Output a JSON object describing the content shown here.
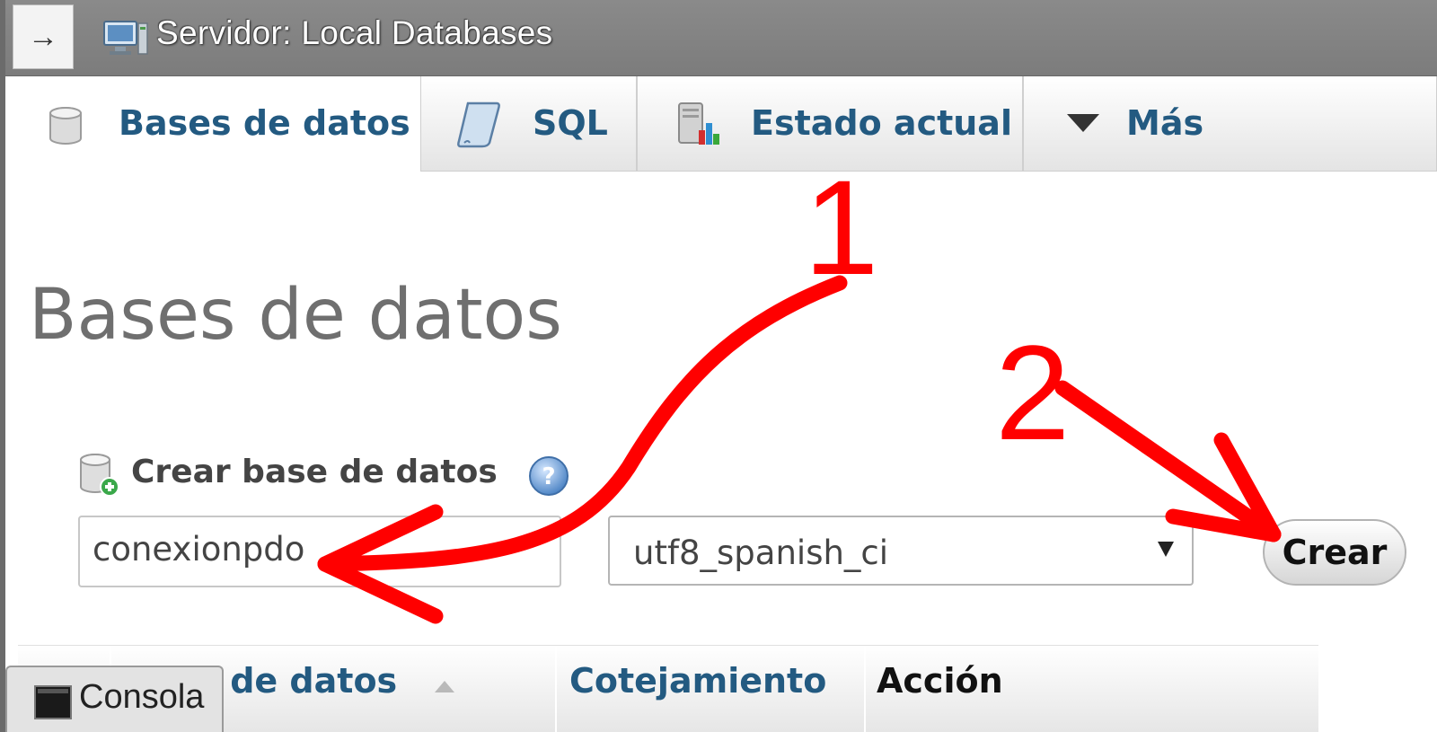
{
  "topbar": {
    "toggle_symbol": "→",
    "server_title": "Servidor: Local Databases"
  },
  "tabs": [
    {
      "label": "Bases de datos",
      "icon": "database-icon",
      "active": true
    },
    {
      "label": "SQL",
      "icon": "sql-scroll-icon",
      "active": false
    },
    {
      "label": "Estado actual",
      "icon": "status-chart-icon",
      "active": false
    },
    {
      "label": "Más",
      "icon": "triangle-down-icon",
      "active": false
    }
  ],
  "page_title": "Bases de datos",
  "create_db": {
    "label": "Crear base de datos",
    "name_value": "conexionpdo",
    "collation_value": "utf8_spanish_ci",
    "create_button": "Crear"
  },
  "table": {
    "columns": [
      "Base de datos",
      "Cotejamiento",
      "Acción"
    ],
    "sort_indicator": "ascending"
  },
  "console": {
    "label": "Consola"
  },
  "annotations": {
    "step1": "1",
    "step2": "2",
    "color": "#ff0000"
  },
  "colors": {
    "link": "#235a81",
    "topbar": "#858585",
    "annotation": "#ff0000"
  }
}
